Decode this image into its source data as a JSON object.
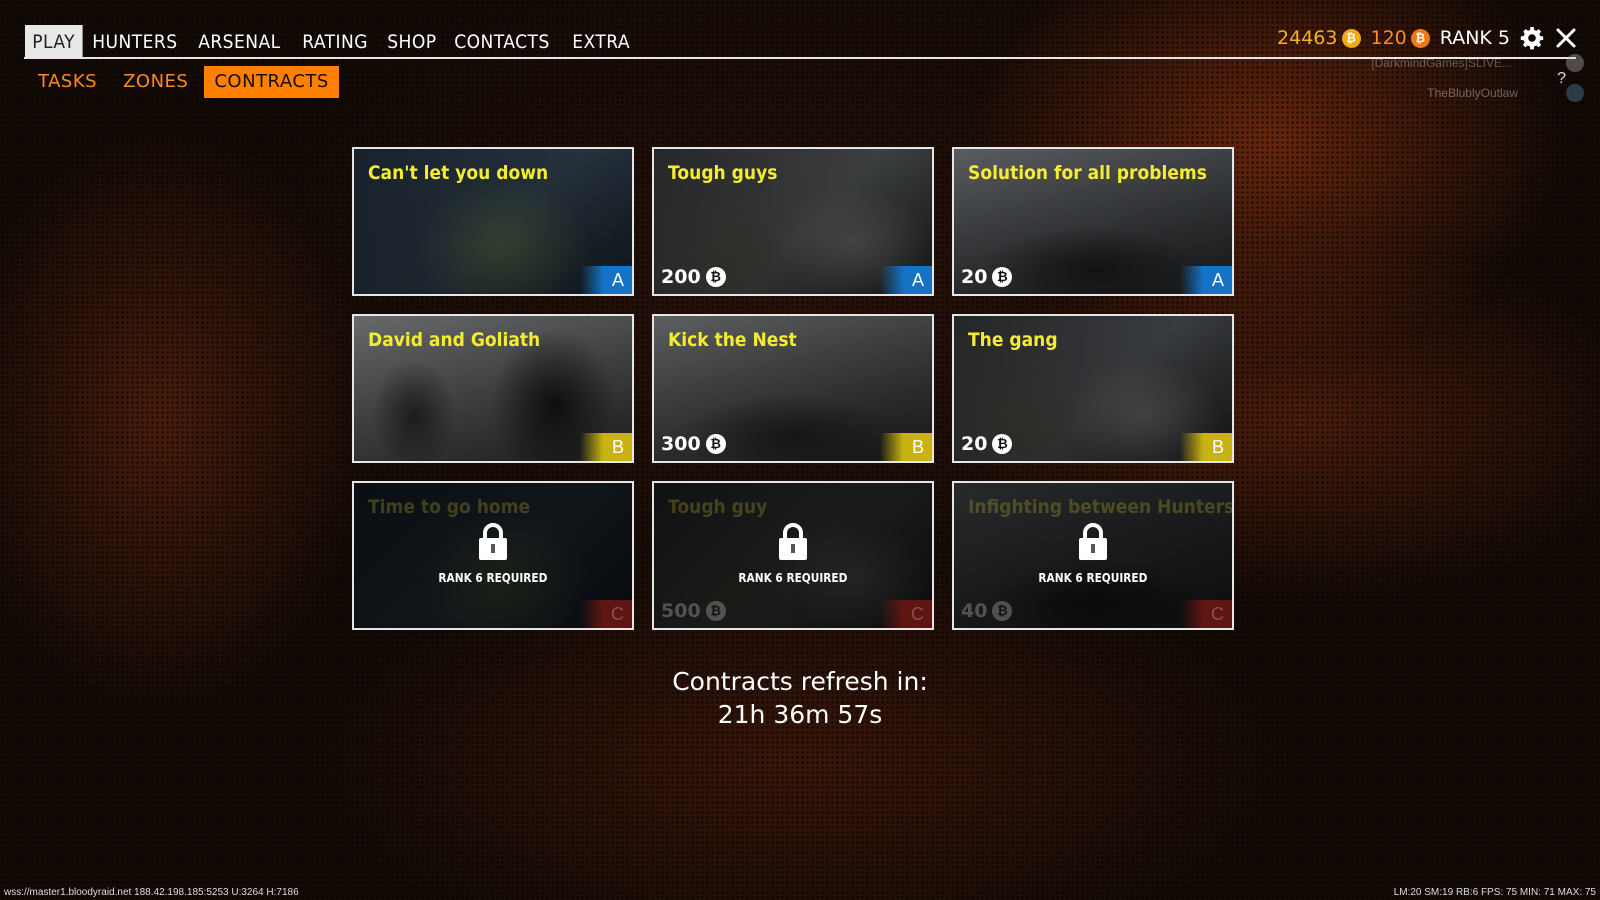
{
  "main_nav": [
    "PLAY",
    "HUNTERS",
    "ARSENAL",
    "RATING",
    "SHOP",
    "CONTACTS",
    "EXTRA"
  ],
  "main_nav_active": "PLAY",
  "sub_nav": [
    "TASKS",
    "ZONES",
    "CONTRACTS"
  ],
  "sub_nav_active": "CONTRACTS",
  "header": {
    "gold": "24463",
    "gold_coin_symbol": "₿",
    "orange": "120",
    "orange_coin_symbol": "₿",
    "rank": "RANK 5",
    "stream_user": "[DarkmindGames]SLIVE...",
    "stream_user2": "TheBlublyOutlaw",
    "help": "?"
  },
  "contracts": [
    {
      "title": "Can't let you down",
      "reward": "",
      "grade": "A",
      "locked": false,
      "lock_text": ""
    },
    {
      "title": "Tough guys",
      "reward": "200",
      "grade": "A",
      "locked": false,
      "lock_text": ""
    },
    {
      "title": "Solution for all problems",
      "reward": "20",
      "grade": "A",
      "locked": false,
      "lock_text": ""
    },
    {
      "title": "David and Goliath",
      "reward": "",
      "grade": "B",
      "locked": false,
      "lock_text": ""
    },
    {
      "title": "Kick the Nest",
      "reward": "300",
      "grade": "B",
      "locked": false,
      "lock_text": ""
    },
    {
      "title": "The gang",
      "reward": "20",
      "grade": "B",
      "locked": false,
      "lock_text": ""
    },
    {
      "title": "Time to go home",
      "reward": "",
      "grade": "C",
      "locked": true,
      "lock_text": "RANK 6 REQUIRED"
    },
    {
      "title": "Tough guy",
      "reward": "500",
      "grade": "C",
      "locked": true,
      "lock_text": "RANK 6 REQUIRED"
    },
    {
      "title": "Infighting between Hunters",
      "reward": "40",
      "grade": "C",
      "locked": true,
      "lock_text": "RANK 6 REQUIRED"
    }
  ],
  "refresh": {
    "label": "Contracts refresh in:",
    "time": "21h 36m 57s"
  },
  "status_bar": {
    "left": "wss://master1.bloodyraid.net  188.42.198.185:5253 U:3264 H:7186",
    "right": "LM:20 SM:19 RB:6 FPS: 75 MIN: 71 MAX: 75"
  },
  "colors": {
    "accent_orange": "#ff8000",
    "title_yellow": "#f4ec33",
    "grade_a": "#1572c4",
    "grade_b": "#c9b312"
  }
}
